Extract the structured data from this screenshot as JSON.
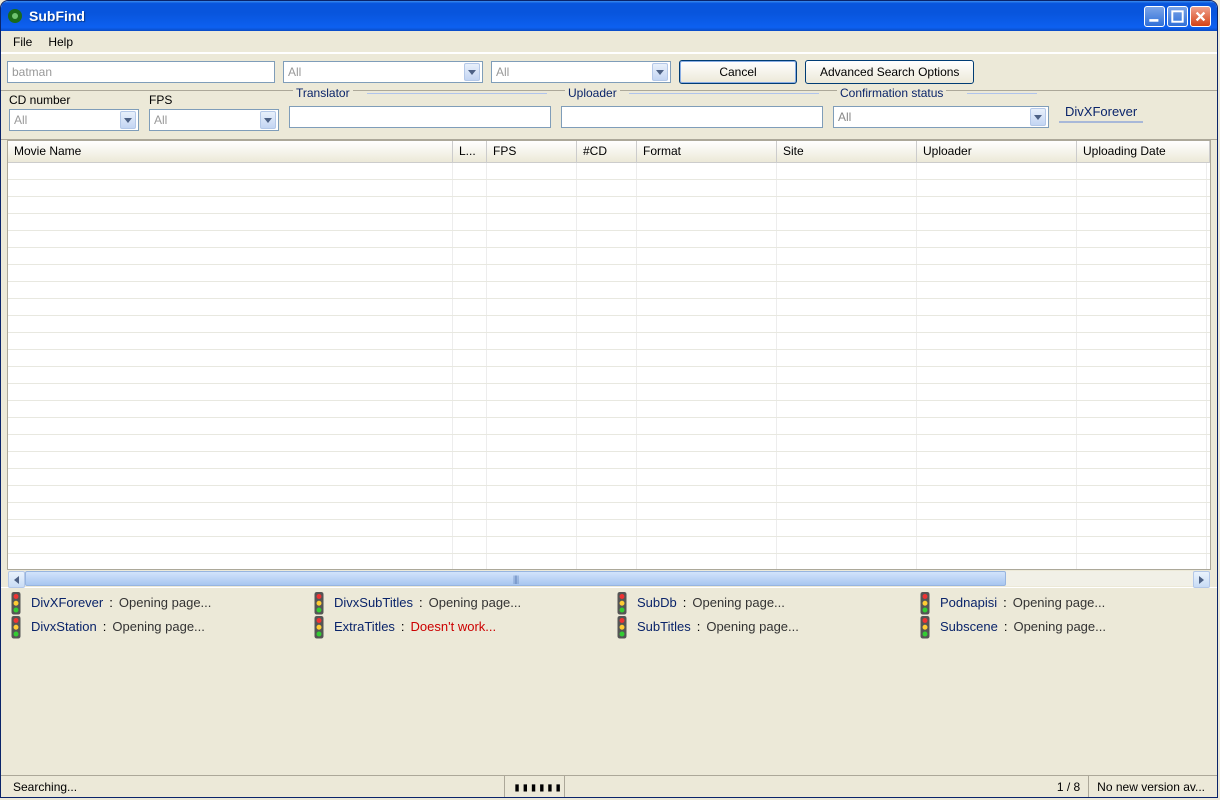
{
  "window": {
    "title": "SubFind"
  },
  "menu": {
    "file": "File",
    "help": "Help"
  },
  "toolbar": {
    "search_value": "batman",
    "lang_value": "All",
    "site_value": "All",
    "cancel": "Cancel",
    "advanced": "Advanced Search Options"
  },
  "filters": {
    "cd_label": "CD number",
    "cd_value": "All",
    "fps_label": "FPS",
    "fps_value": "All",
    "translator_legend": "Translator",
    "uploader_legend": "Uploader",
    "confirm_legend": "Confirmation status",
    "confirm_value": "All",
    "site_tab": "DivXForever"
  },
  "columns": {
    "movie": "Movie Name",
    "lang": "L...",
    "fps": "FPS",
    "cd": "#CD",
    "format": "Format",
    "site": "Site",
    "uploader": "Uploader",
    "date": "Uploading Date"
  },
  "sites": [
    {
      "name": "DivXForever",
      "status": "Opening page...",
      "err": false
    },
    {
      "name": "DivxSubTitles",
      "status": "Opening page...",
      "err": false
    },
    {
      "name": "SubDb",
      "status": "Opening page...",
      "err": false
    },
    {
      "name": "Podnapisi",
      "status": "Opening page...",
      "err": false
    },
    {
      "name": "DivxStation",
      "status": "Opening page...",
      "err": false
    },
    {
      "name": "ExtraTitles",
      "status": "Doesn't work...",
      "err": true
    },
    {
      "name": "SubTitles",
      "status": "Opening page...",
      "err": false
    },
    {
      "name": "Subscene",
      "status": "Opening page...",
      "err": false
    }
  ],
  "status": {
    "searching": "Searching...",
    "progress": "▮▮▮▮▮▮",
    "count": "1 / 8",
    "version": "No new version av..."
  }
}
